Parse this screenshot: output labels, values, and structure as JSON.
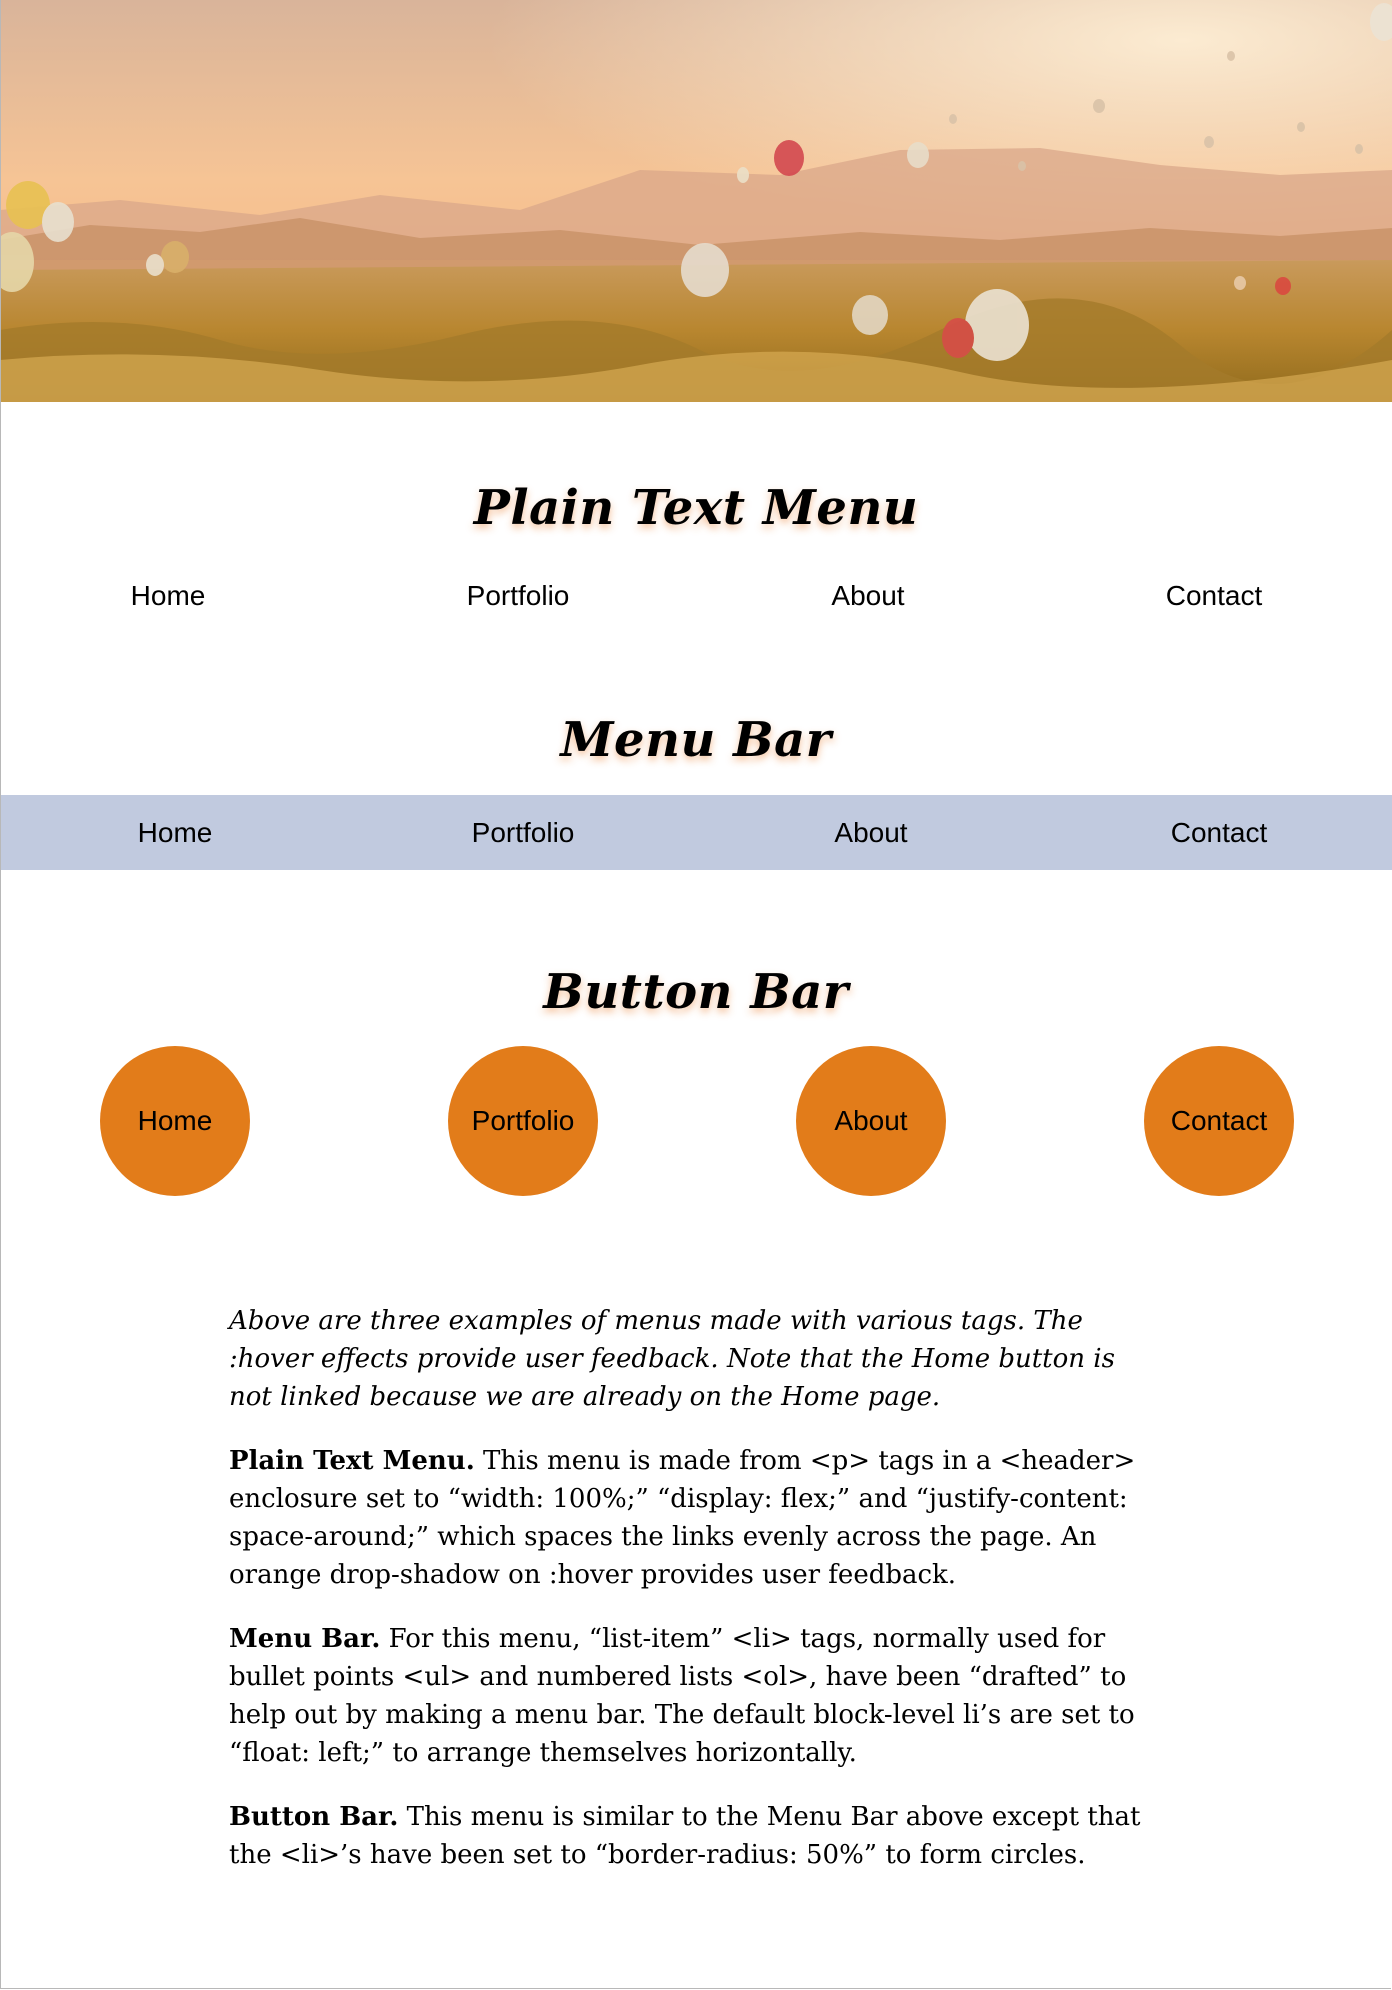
{
  "hero": {
    "image": "hot-air-balloons-over-cappadocia-landscape"
  },
  "sections": {
    "plain_text_title": "Plain Text Menu",
    "menu_bar_title": "Menu Bar",
    "button_bar_title": "Button Bar"
  },
  "plain_menu": [
    "Home",
    "Portfolio",
    "About",
    "Contact"
  ],
  "menu_bar": [
    "Home",
    "Portfolio",
    "About",
    "Contact"
  ],
  "button_bar": [
    "Home",
    "Portfolio",
    "About",
    "Contact"
  ],
  "colors": {
    "menu_bar_bg": "#c1cadf",
    "button_bg": "#e27c1a",
    "title_glow": "#e87a28"
  },
  "text": {
    "intro": "Above are three examples of menus made with various tags. The :hover effects provide user feedback. Note that the Home button is not linked because we are already on the Home page.",
    "plain_heading": "Plain Text Menu.",
    "plain_body": "This menu is made from <p> tags in a <header> enclosure set to “width: 100%;” “display: flex;” and “justify-content: space-around;” which spaces the links evenly across the page. An orange drop-shadow on :hover provides user feedback.",
    "menu_heading": "Menu Bar.",
    "menu_body": "For this menu, “list-item” <li> tags, normally used for bullet points <ul> and numbered lists <ol>, have been “drafted” to help out by making a menu bar. The default block-level li’s are set to “float: left;” to arrange themselves horizontally.",
    "button_heading": "Button Bar.",
    "button_body": "This menu is similar to the Menu Bar above except that the <li>’s have been set to “border-radius: 50%” to form circles."
  }
}
